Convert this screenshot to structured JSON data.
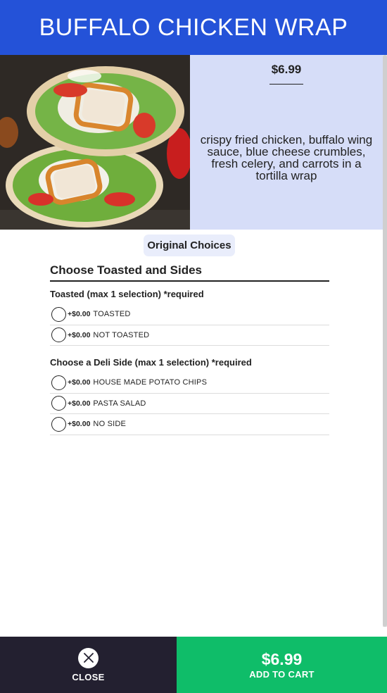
{
  "header": {
    "title": "BUFFALO CHICKEN WRAP"
  },
  "item": {
    "price": "$6.99",
    "description": "crispy fried chicken, buffalo wing sauce, blue cheese crumbles, fresh celery, and carrots in a tortilla wrap"
  },
  "choices": {
    "pill_label": "Original Choices",
    "section_title": "Choose Toasted and Sides",
    "groups": [
      {
        "title": "Toasted (max 1 selection) *required",
        "options": [
          {
            "price": "+$0.00",
            "label": "TOASTED"
          },
          {
            "price": "+$0.00",
            "label": "NOT TOASTED"
          }
        ]
      },
      {
        "title": "Choose a Deli Side (max 1 selection) *required",
        "options": [
          {
            "price": "+$0.00",
            "label": "HOUSE MADE POTATO CHIPS"
          },
          {
            "price": "+$0.00",
            "label": "PASTA SALAD"
          },
          {
            "price": "+$0.00",
            "label": "NO SIDE"
          }
        ]
      }
    ]
  },
  "footer": {
    "close_label": "CLOSE",
    "cart_price": "$6.99",
    "cart_label": "ADD TO CART"
  },
  "icons": {
    "close": "close-icon",
    "radio": "radio-unselected"
  },
  "colors": {
    "header": "#2452d8",
    "info_panel": "#d6ddf8",
    "close_bg": "#232030",
    "cart_bg": "#0fbd69"
  }
}
